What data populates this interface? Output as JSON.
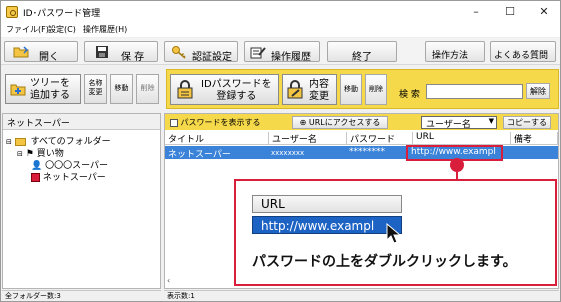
{
  "window": {
    "title": "ID･パスワード管理",
    "controls": [
      "–",
      "☐",
      "✕"
    ]
  },
  "menu": [
    "ファイル(F)",
    "設定(C)",
    "操作履歴(H)"
  ],
  "toolbar1": {
    "open": "開く",
    "save": "保 存",
    "auth": "認証設定",
    "history": "操作履歴",
    "exit": "終了",
    "howto": "操作方法",
    "faq": "よくある質問"
  },
  "toolbar2": {
    "add_tree": "ツリーを\n追加する",
    "rename": "名称\n変更",
    "move": "移動",
    "delete": "削除",
    "register": "IDパスワードを\n登録する",
    "edit": "内容\n変更",
    "move2": "移動",
    "delete2": "削除",
    "search_label": "検 索",
    "search_value": "",
    "cancel": "解除",
    "show_password": "パスワードを表示する",
    "url_access": "URLにアクセスする",
    "sort_select": "ユーザー名",
    "copy": "コピーする"
  },
  "left_panel": {
    "header": "ネットスーパー",
    "tree": [
      "すべてのフォルダー",
      "買い物",
      "〇〇〇スーパー",
      "ネットスーパー"
    ]
  },
  "table": {
    "columns": [
      "タイトル",
      "ユーザー名",
      "パスワード",
      "URL",
      "備考"
    ],
    "rows": [
      {
        "title": "ネットスーパー",
        "user": "xxxxxxxx",
        "password": "********",
        "url": "http://www.exampl",
        "note": ""
      }
    ]
  },
  "status": {
    "left": "全フォルダー数:3",
    "right": "表示数:1"
  },
  "callout": {
    "label": "URL",
    "value": "http://www.exampl",
    "instruction": "パスワードの上をダブルクリックします。"
  },
  "colors": {
    "accent_yellow": "#f5d94a",
    "selection_blue": "#3b83d9",
    "callout_red": "#d81e3a"
  }
}
